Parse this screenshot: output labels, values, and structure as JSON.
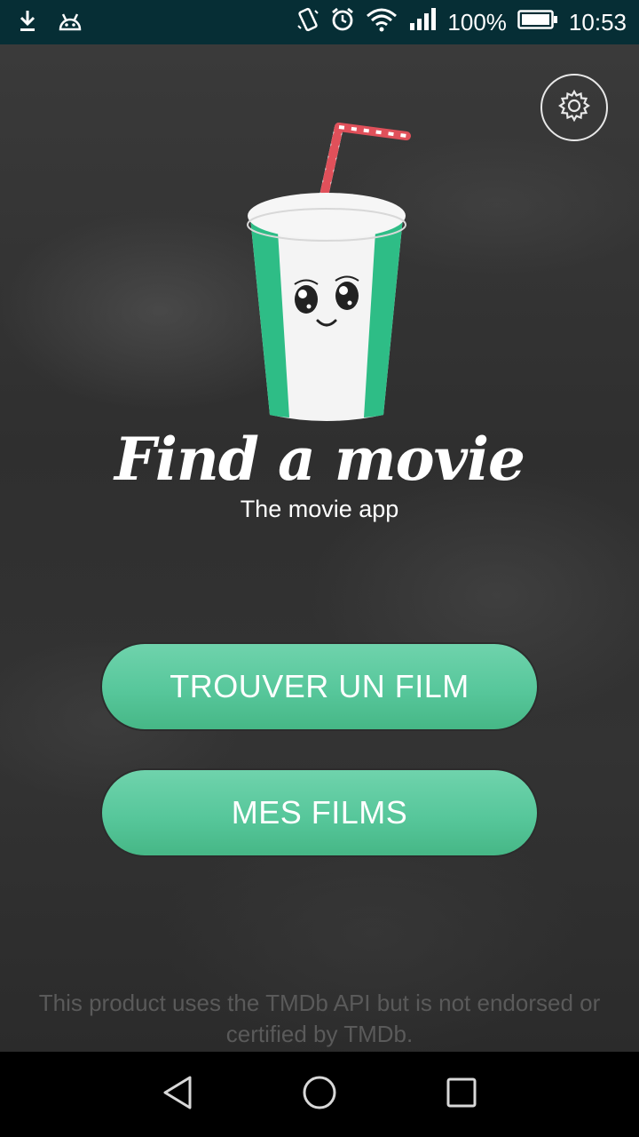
{
  "status_bar": {
    "battery": "100%",
    "time": "10:53",
    "icons": [
      "download-icon",
      "android-icon",
      "vibrate-icon",
      "alarm-icon",
      "wifi-icon",
      "signal-icon",
      "battery-icon"
    ]
  },
  "header": {
    "settings_icon": "gear-icon"
  },
  "logo": {
    "title": "Find a movie",
    "subtitle": "The movie app"
  },
  "actions": {
    "find_label": "TROUVER UN FILM",
    "mine_label": "MES FILMS"
  },
  "footer": {
    "disclaimer": "This product uses the TMDb API but is not endorsed or certified by TMDb."
  },
  "nav": {
    "icons": [
      "back-icon",
      "home-icon",
      "recents-icon"
    ]
  },
  "colors": {
    "accent": "#57c79b",
    "status_bar": "#062e35",
    "cup_green": "#2ebd86",
    "straw_red": "#e0505a"
  }
}
